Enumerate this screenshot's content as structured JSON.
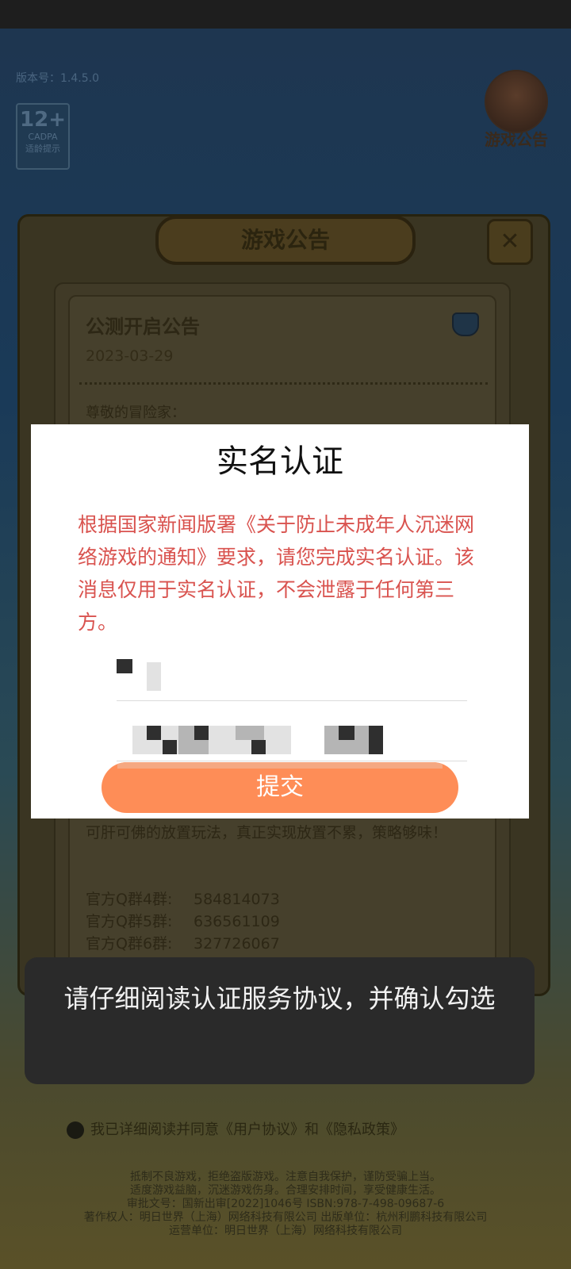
{
  "game": {
    "version": "版本号：1.4.5.0",
    "age_badge": {
      "rating": "12+",
      "label": "适龄提示",
      "sub": "CADPA"
    },
    "notice_button_label": "游戏公告",
    "panel_title": "游戏公告",
    "close_symbol": "✕",
    "announcement": {
      "title": "公测开启公告",
      "date": "2023-03-29",
      "greeting": "尊敬的冒险家：",
      "body": "可肝可佛的放置玩法，真正实现放置不累，策略够味！",
      "groups": [
        {
          "label": "官方Q群4群:",
          "value": "584814073"
        },
        {
          "label": "官方Q群5群:",
          "value": "636561109"
        },
        {
          "label": "官方Q群6群:",
          "value": "327726067"
        }
      ]
    },
    "agreement": "我已详细阅读并同意《用户协议》和《隐私政策》",
    "footer": [
      "抵制不良游戏，拒绝盗版游戏。注意自我保护，谨防受骗上当。",
      "适度游戏益脑，沉迷游戏伤身。合理安排时间，享受健康生活。",
      "审批文号：国新出审[2022]1046号    ISBN:978-7-498-09687-6",
      "著作权人：明日世界（上海）网络科技有限公司    出版单位：杭州利鹏科技有限公司",
      "运营单位：明日世界（上海）网络科技有限公司"
    ]
  },
  "dialog": {
    "title": "实名认证",
    "message": "根据国家新闻版署《关于防止未成年人沉迷网络游戏的通知》要求，请您完成实名认证。该消息仅用于实名认证，不会泄露于任何第三方。",
    "submit_label": "提交"
  },
  "toast": {
    "message": "请仔细阅读认证服务协议，并确认勾选"
  },
  "colors": {
    "message_red": "#d9534f",
    "submit_orange": "#fe8d57",
    "toast_bg": "#2a2a2a"
  }
}
